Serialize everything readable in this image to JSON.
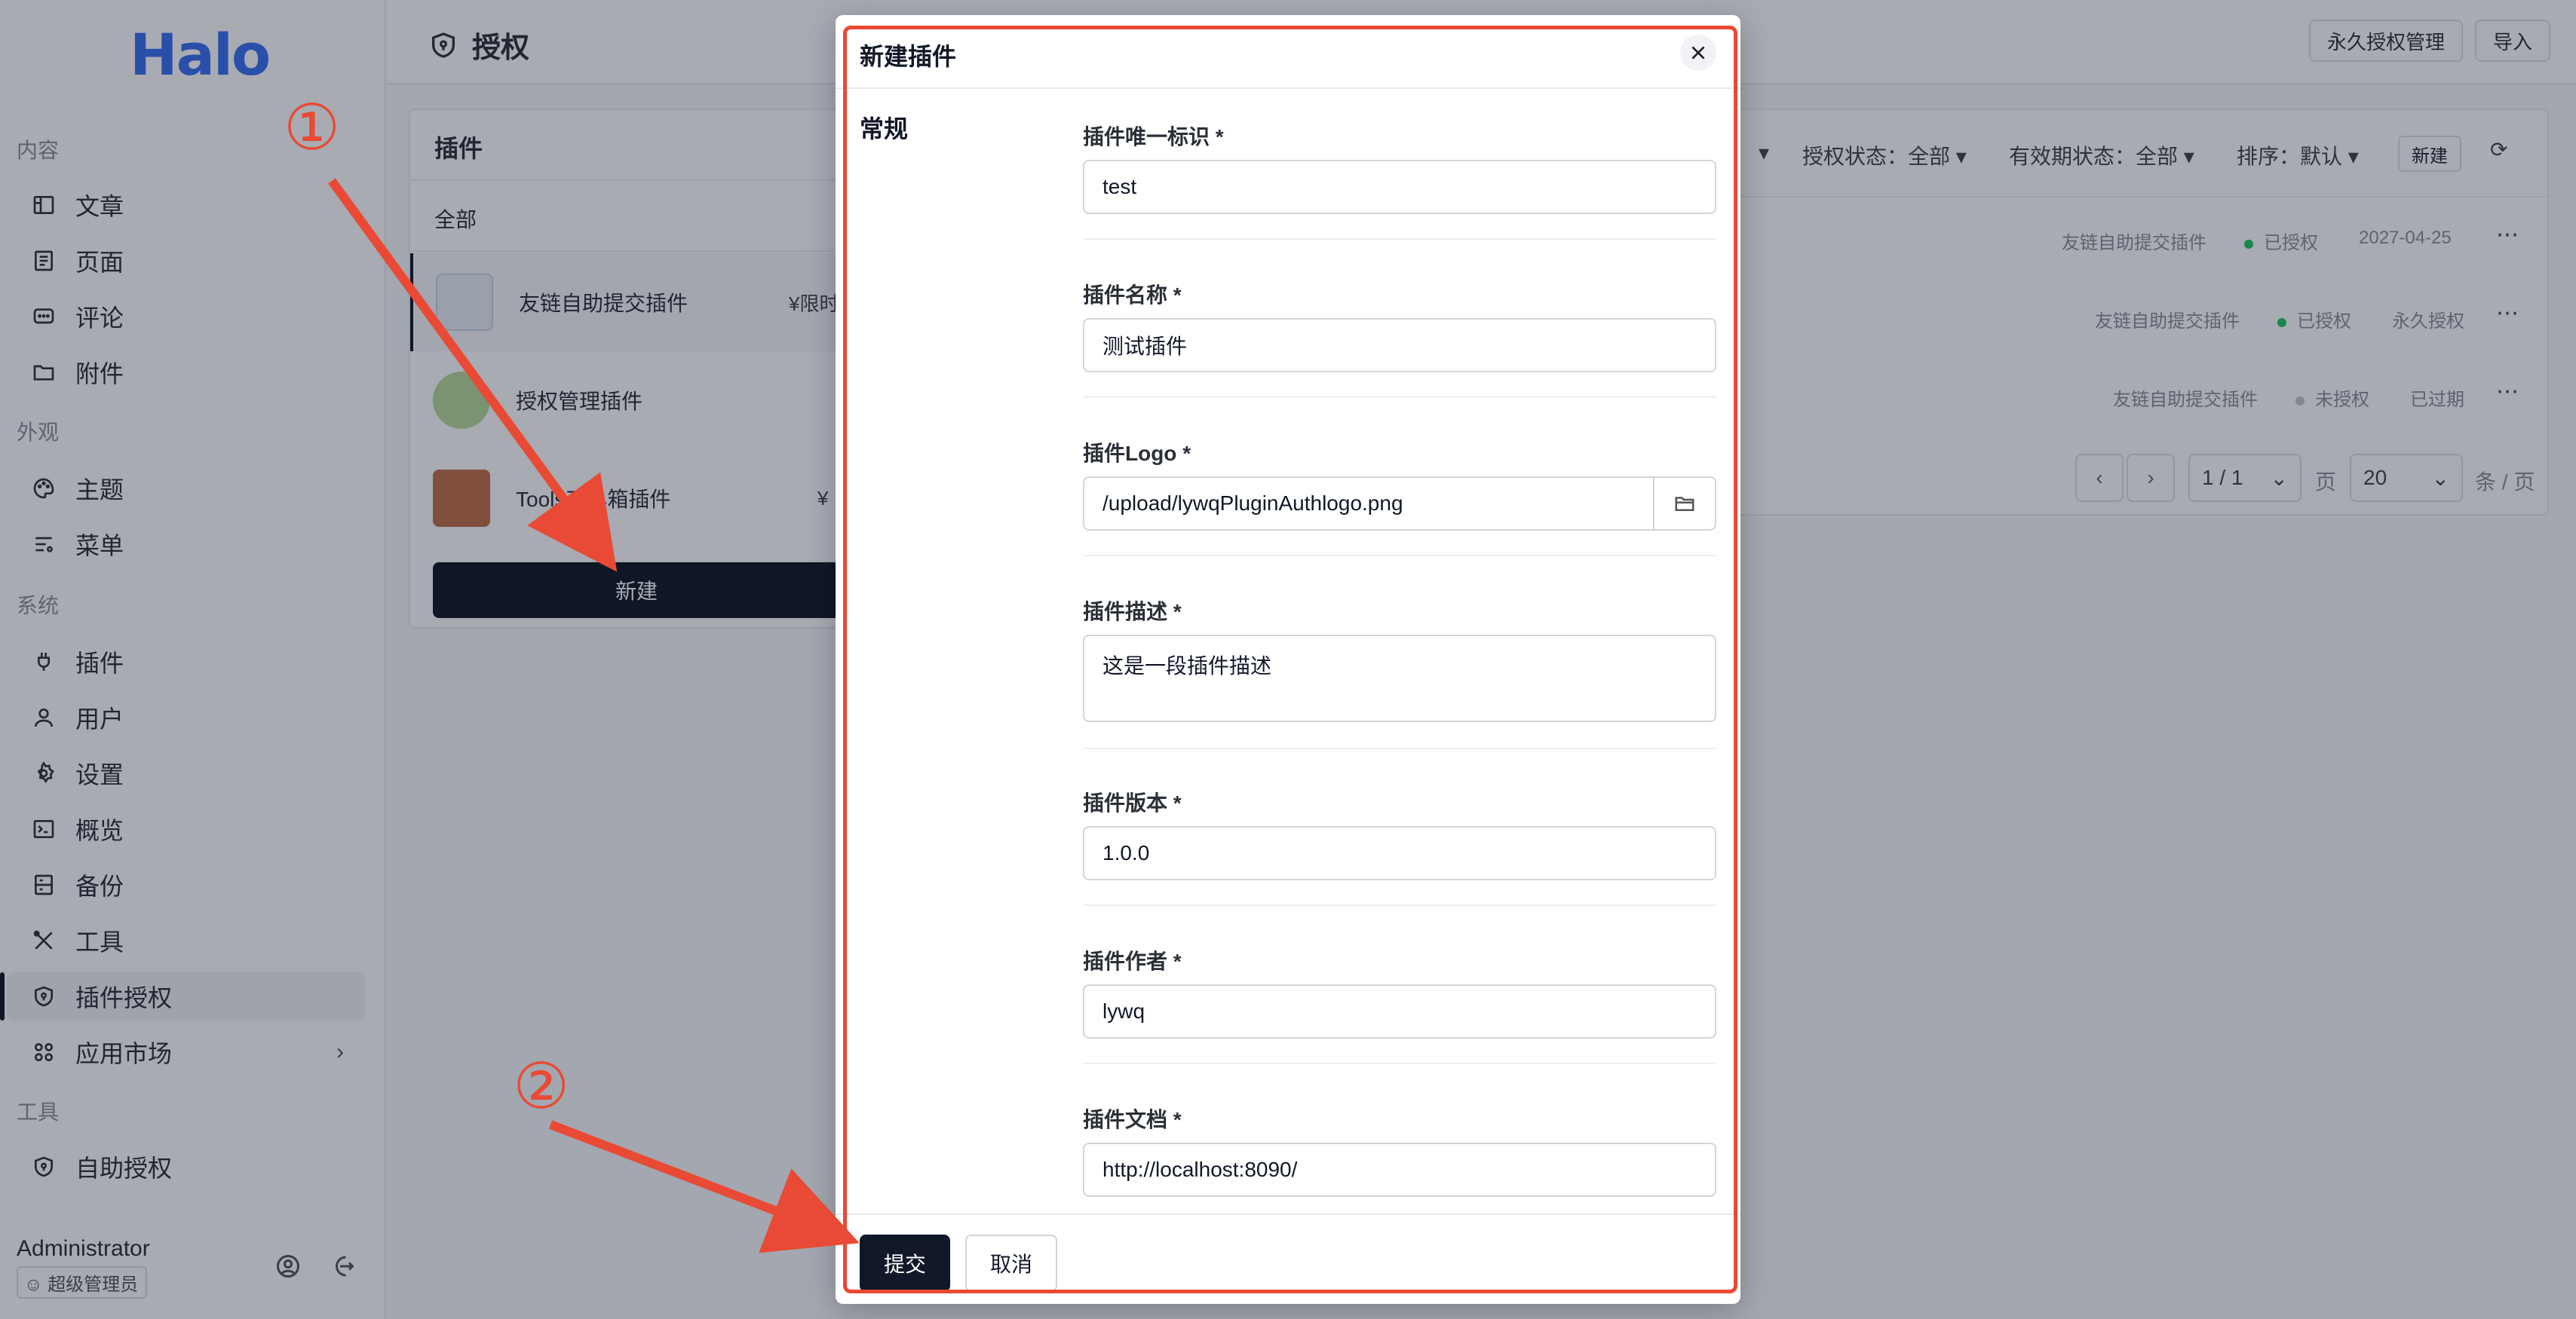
{
  "app": {
    "logo": "Halo"
  },
  "sidebar": {
    "groups": [
      {
        "title": "内容",
        "items": [
          {
            "label": "文章",
            "icon": "book-icon"
          },
          {
            "label": "页面",
            "icon": "page-icon"
          },
          {
            "label": "评论",
            "icon": "comment-icon"
          },
          {
            "label": "附件",
            "icon": "folder-icon"
          }
        ]
      },
      {
        "title": "外观",
        "items": [
          {
            "label": "主题",
            "icon": "palette-icon"
          },
          {
            "label": "菜单",
            "icon": "menu-icon"
          }
        ]
      },
      {
        "title": "系统",
        "items": [
          {
            "label": "插件",
            "icon": "plug-icon"
          },
          {
            "label": "用户",
            "icon": "user-icon"
          },
          {
            "label": "设置",
            "icon": "gear-icon"
          },
          {
            "label": "概览",
            "icon": "terminal-icon"
          },
          {
            "label": "备份",
            "icon": "backup-icon"
          },
          {
            "label": "工具",
            "icon": "tools-icon"
          },
          {
            "label": "插件授权",
            "icon": "shield-icon",
            "active": true
          },
          {
            "label": "应用市场",
            "icon": "grid-icon"
          }
        ]
      },
      {
        "title": "工具",
        "items": [
          {
            "label": "自助授权",
            "icon": "shield-icon"
          }
        ]
      }
    ],
    "user": {
      "name": "Administrator",
      "role": "超级管理员"
    }
  },
  "header": {
    "title": "授权",
    "buttons": [
      "永久授权管理",
      "导入"
    ]
  },
  "left_panel": {
    "title": "插件",
    "filter": "全部",
    "plugins": [
      {
        "name": "友链自助提交插件",
        "price": "¥限时"
      },
      {
        "name": "授权管理插件",
        "price": ""
      },
      {
        "name": "Tools工具箱插件",
        "price": "¥"
      }
    ],
    "new_button": "新建"
  },
  "right_panel": {
    "filters": [
      "授权状态：全部",
      "有效期状态：全部",
      "排序：默认"
    ],
    "new_button": "新建",
    "rows": [
      {
        "plugin": "友链自助提交插件",
        "status": "已授权",
        "status_color": "#22c55e",
        "expiry": "2027-04-25"
      },
      {
        "plugin": "友链自助提交插件",
        "status": "已授权",
        "status_color": "#22c55e",
        "expiry": "永久授权"
      },
      {
        "plugin": "友链自助提交插件",
        "status": "未授权",
        "status_color": "#c4c8cf",
        "expiry": "已过期"
      }
    ],
    "pager": {
      "page": "1 / 1",
      "page_unit": "页",
      "size": "20",
      "size_unit": "条 / 页"
    }
  },
  "modal": {
    "title": "新建插件",
    "section": "常规",
    "fields": {
      "id": {
        "label": "插件唯一标识 *",
        "value": "test"
      },
      "name": {
        "label": "插件名称 *",
        "value": "测试插件"
      },
      "logo": {
        "label": "插件Logo *",
        "value": "/upload/lywqPluginAuthlogo.png"
      },
      "desc": {
        "label": "插件描述 *",
        "value": "这是一段插件描述"
      },
      "version": {
        "label": "插件版本 *",
        "value": "1.0.0"
      },
      "author": {
        "label": "插件作者 *",
        "value": "lywq"
      },
      "doc": {
        "label": "插件文档 *",
        "value": "http://localhost:8090/"
      }
    },
    "submit": "提交",
    "cancel": "取消"
  },
  "annotations": {
    "step1": "①",
    "step2": "②",
    "color": "#e84a35"
  }
}
